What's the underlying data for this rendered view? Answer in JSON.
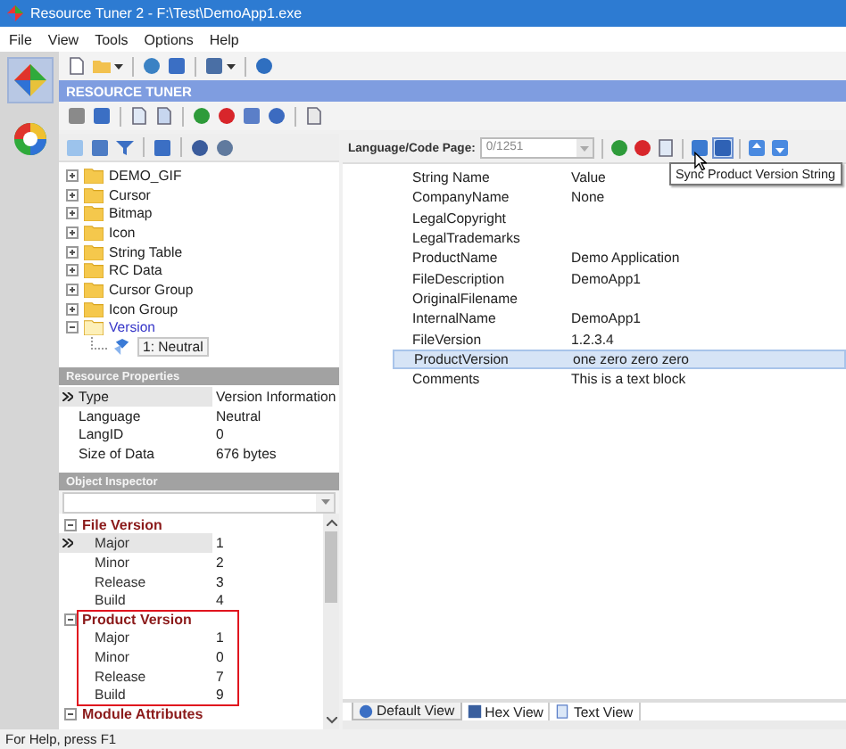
{
  "window": {
    "title": "Resource Tuner 2 - F:\\Test\\DemoApp1.exe"
  },
  "menu": [
    "File",
    "View",
    "Tools",
    "Options",
    "Help"
  ],
  "app_header": "RESOURCE TUNER",
  "tree": [
    {
      "label": "DEMO_GIF",
      "expanded": false
    },
    {
      "label": "Cursor",
      "expanded": false
    },
    {
      "label": "Bitmap",
      "expanded": false
    },
    {
      "label": "Icon",
      "expanded": false
    },
    {
      "label": "String Table",
      "expanded": false
    },
    {
      "label": "RC Data",
      "expanded": false
    },
    {
      "label": "Cursor Group",
      "expanded": false
    },
    {
      "label": "Icon Group",
      "expanded": false
    },
    {
      "label": "Version",
      "expanded": true,
      "children": [
        {
          "label": "1: Neutral",
          "selected": true
        }
      ]
    }
  ],
  "resource_properties": {
    "title": "Resource Properties",
    "rows": [
      {
        "name": "Type",
        "value": "Version Information",
        "selected": true
      },
      {
        "name": "Language",
        "value": "Neutral",
        "selected": false
      },
      {
        "name": "LangID",
        "value": "0",
        "selected": false
      },
      {
        "name": "Size of Data",
        "value": "676 bytes",
        "selected": false
      }
    ]
  },
  "object_inspector": {
    "title": "Object Inspector",
    "groups": [
      {
        "title": "File Version",
        "expanded": true,
        "highlighted": false,
        "rows": [
          {
            "name": "Major",
            "value": "1",
            "selected": true
          },
          {
            "name": "Minor",
            "value": "2",
            "selected": false
          },
          {
            "name": "Release",
            "value": "3",
            "selected": false
          },
          {
            "name": "Build",
            "value": "4",
            "selected": false
          }
        ]
      },
      {
        "title": "Product Version",
        "expanded": true,
        "highlighted": true,
        "rows": [
          {
            "name": "Major",
            "value": "1",
            "selected": false
          },
          {
            "name": "Minor",
            "value": "0",
            "selected": false
          },
          {
            "name": "Release",
            "value": "7",
            "selected": false
          },
          {
            "name": "Build",
            "value": "9",
            "selected": false
          }
        ]
      },
      {
        "title": "Module Attributes",
        "expanded": true,
        "highlighted": false
      }
    ]
  },
  "code_page": {
    "label": "Language/Code Page:",
    "value": "0/1251"
  },
  "tooltip": "Sync Product Version String",
  "table": {
    "columns": [
      "String Name",
      "Value"
    ],
    "rows": [
      {
        "name": "CompanyName",
        "value": "None",
        "selected": false
      },
      {
        "name": "LegalCopyright",
        "selected": false
      },
      {
        "name": "LegalTrademarks",
        "selected": false
      },
      {
        "name": "ProductName",
        "value": "Demo Application",
        "selected": false
      },
      {
        "name": "FileDescription",
        "value": "DemoApp1",
        "selected": false
      },
      {
        "name": "OriginalFilename",
        "selected": false
      },
      {
        "name": "InternalName",
        "value": "DemoApp1",
        "selected": false
      },
      {
        "name": "FileVersion",
        "value": "1.2.3.4",
        "selected": false
      },
      {
        "name": "ProductVersion",
        "value": "one zero zero zero",
        "selected": true
      },
      {
        "name": "Comments",
        "value": "This is a text block",
        "selected": false
      }
    ]
  },
  "view_tabs": [
    {
      "label": "Default View",
      "selected": true
    },
    {
      "label": "Hex View",
      "selected": false
    },
    {
      "label": "Text View",
      "selected": false
    }
  ],
  "status_bar": "For Help, press F1"
}
